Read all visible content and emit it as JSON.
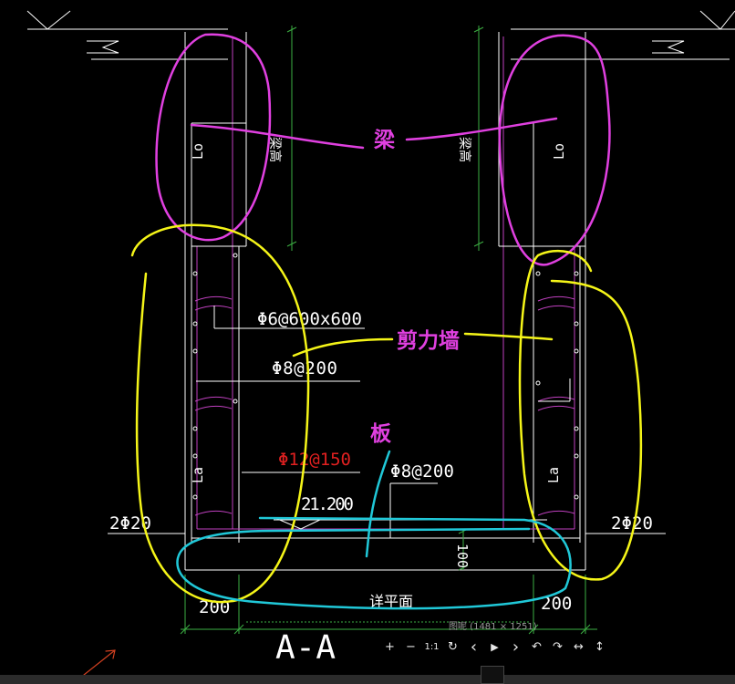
{
  "labels": {
    "beam": "梁",
    "shear_wall": "剪力墙",
    "slab": "板",
    "beam_vert_left": "梁高",
    "beam_vert_right": "梁高",
    "lo_top_left": "Lo",
    "lo_top_right": "Lo",
    "lo_bottom_left": "La",
    "lo_bottom_right": "La",
    "stirrup_tie": "Φ6@600x600",
    "wall_bar": "Φ8@200",
    "slab_bar_red": "Φ12@150",
    "slab_bar": "Φ8@200",
    "elevation": "21.200",
    "rebar_left": "2Φ20",
    "rebar_right": "2Φ20",
    "dim_100": "100",
    "dim_200_left": "200",
    "dim_200_right": "200",
    "detail_note": "详平面",
    "section_title": "A-A"
  },
  "colors": {
    "background": "#000000",
    "cad_line": "#ffffff",
    "cad_dim": "#3cb043",
    "cad_magenta": "#c040c0",
    "cad_red": "#e02020",
    "mark_magenta": "#e040e0",
    "mark_yellow": "#f5f518",
    "mark_cyan": "#20c8d8"
  },
  "viewer": {
    "image_info": "图呢 (1481 × 1251)"
  },
  "toolbar": {
    "zoom_in": "+",
    "zoom_out": "−",
    "actual_size": "1:1",
    "rotate": "↻",
    "prev": "‹",
    "play": "▶",
    "next": "›",
    "rotate_left": "↶",
    "rotate_right": "↷",
    "flip_h": "↔",
    "flip_v": "↕"
  }
}
